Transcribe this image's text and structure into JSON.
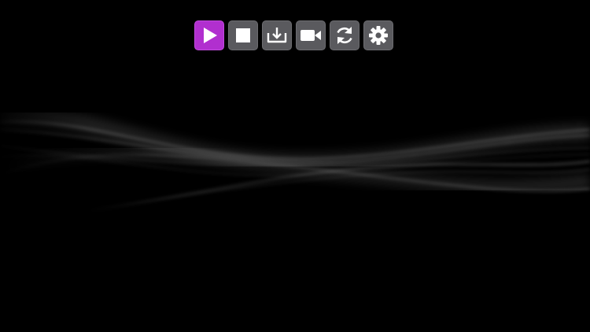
{
  "toolbar": {
    "buttons": [
      {
        "icon": "play-icon",
        "active": true
      },
      {
        "icon": "stop-icon",
        "active": false
      },
      {
        "icon": "download-icon",
        "active": false
      },
      {
        "icon": "video-camera-icon",
        "active": false
      },
      {
        "icon": "refresh-icon",
        "active": false
      },
      {
        "icon": "gear-icon",
        "active": false
      }
    ]
  },
  "colors": {
    "background": "#000000",
    "button_bg": "#5a5a5e",
    "active_accent": "#b12fcf",
    "icon": "#ffffff"
  }
}
